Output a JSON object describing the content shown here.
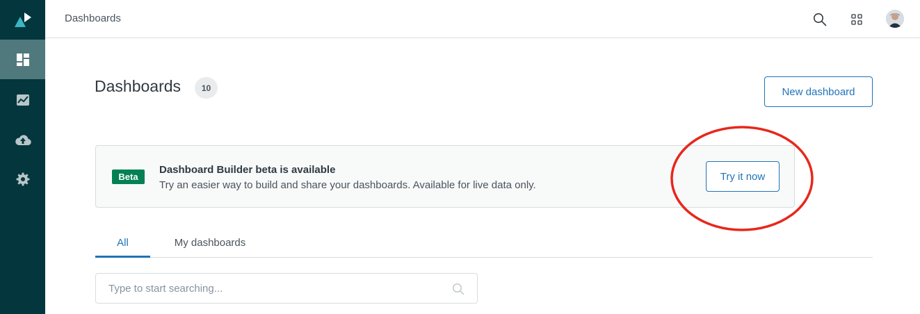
{
  "topbar": {
    "title": "Dashboards",
    "icons": [
      "search-icon",
      "apps-grid-icon"
    ]
  },
  "sidebar": {
    "logo": "product-logo-icon",
    "items": [
      {
        "icon": "dashboard-icon",
        "active": true
      },
      {
        "icon": "chart-icon",
        "active": false
      },
      {
        "icon": "cloud-upload-icon",
        "active": false
      },
      {
        "icon": "gear-icon",
        "active": false
      }
    ]
  },
  "header": {
    "title": "Dashboards",
    "count": "10",
    "new_button": "New dashboard"
  },
  "banner": {
    "badge": "Beta",
    "title": "Dashboard Builder beta is available",
    "description": "Try an easier way to build and share your dashboards. Available for live data only.",
    "button": "Try it now"
  },
  "tabs": [
    {
      "label": "All",
      "active": true
    },
    {
      "label": "My dashboards",
      "active": false
    }
  ],
  "search": {
    "placeholder": "Type to start searching...",
    "value": ""
  },
  "colors": {
    "sidebar": "#03363d",
    "sidebar_active": "#4f797d",
    "accent": "#1f73b7",
    "beta": "#038153",
    "annotation": "#e8271b"
  }
}
